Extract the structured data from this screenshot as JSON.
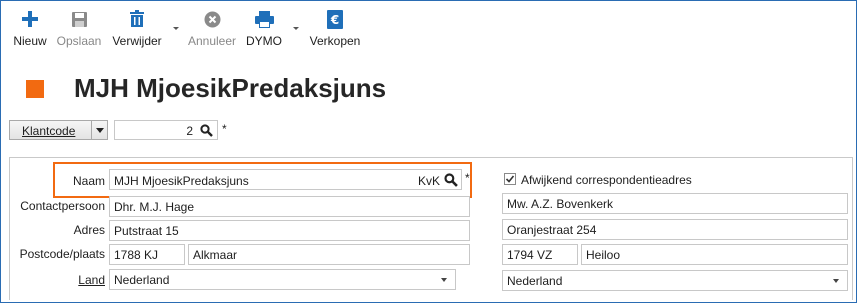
{
  "toolbar": {
    "new_label": "Nieuw",
    "save_label": "Opslaan",
    "delete_label": "Verwijder",
    "cancel_label": "Annuleer",
    "dymo_label": "DYMO",
    "sell_label": "Verkopen"
  },
  "header": {
    "title": "MJH MjoesikPredaksjuns",
    "accent_color": "#F26A11"
  },
  "selector": {
    "label": "Klantcode",
    "code_value": "2",
    "required_mark": "*"
  },
  "form": {
    "name_label": "Naam",
    "name_value": "MJH MjoesikPredaksjuns",
    "kvk_label": "KvK",
    "name_required": "*",
    "contact_label": "Contactpersoon",
    "contact_value": "Dhr. M.J. Hage",
    "address_label": "Adres",
    "address_value": "Putstraat 15",
    "postcode_label": "Postcode/plaats",
    "postcode_value": "1788 KJ",
    "city_value": "Alkmaar",
    "country_label": "Land",
    "country_value": "Nederland"
  },
  "correspondence": {
    "checkbox_label": "Afwijkend correspondentieadres",
    "checked": true,
    "contact_value": "Mw. A.Z. Bovenkerk",
    "address_value": "Oranjestraat 254",
    "postcode_value": "1794 VZ",
    "city_value": "Heiloo",
    "country_value": "Nederland"
  },
  "colors": {
    "icon_blue": "#1f6fb9",
    "icon_gray": "#8a8a8a",
    "frame_blue": "#2a6cb3"
  }
}
